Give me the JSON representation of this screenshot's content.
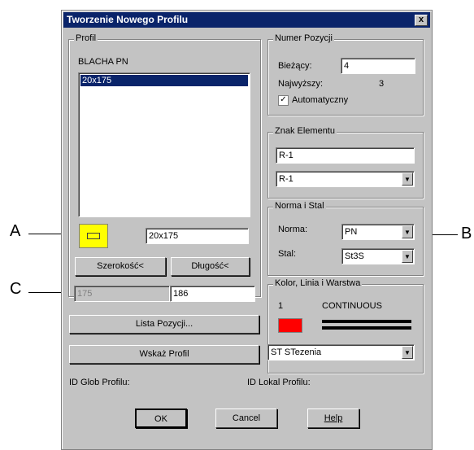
{
  "window": {
    "title": "Tworzenie Nowego Profilu",
    "close_glyph": "x"
  },
  "profil": {
    "group_label": "Profil",
    "type_label": "BLACHA PN",
    "list_items": [
      "20x175"
    ],
    "size_value": "20x175",
    "width_button": "Szerokość<",
    "length_button": "Długość<",
    "disabled_value": "175",
    "length_value": "186",
    "list_button": "Lista Pozycji...",
    "show_button": "Wskaż Profil"
  },
  "numer": {
    "group_label": "Numer Pozycji",
    "current_label": "Bieżący:",
    "current_value": "4",
    "highest_label": "Najwyższy:",
    "highest_value": "3",
    "auto_label": "Automatyczny",
    "auto_checked": true,
    "check_glyph": "✓"
  },
  "znak": {
    "group_label": "Znak Elementu",
    "text_value": "R-1",
    "combo_value": "R-1"
  },
  "norma": {
    "group_label": "Norma i Stal",
    "norma_label": "Norma:",
    "norma_value": "PN",
    "stal_label": "Stal:",
    "stal_value": "St3S"
  },
  "kolor": {
    "group_label": "Kolor, Linia i Warstwa",
    "color_number": "1",
    "line_type": "CONTINUOUS",
    "color_hex": "#ff0000",
    "layer_value": "ST   STezenia"
  },
  "ids": {
    "glob_label": "ID Glob Profilu:",
    "lokal_label": "ID Lokal Profilu:"
  },
  "buttons": {
    "ok": "OK",
    "cancel": "Cancel",
    "help": "Help"
  },
  "annotations": {
    "a": "A",
    "b": "B",
    "c": "C"
  },
  "combo_arrow": "▼",
  "swatch_color": "#ffff00"
}
